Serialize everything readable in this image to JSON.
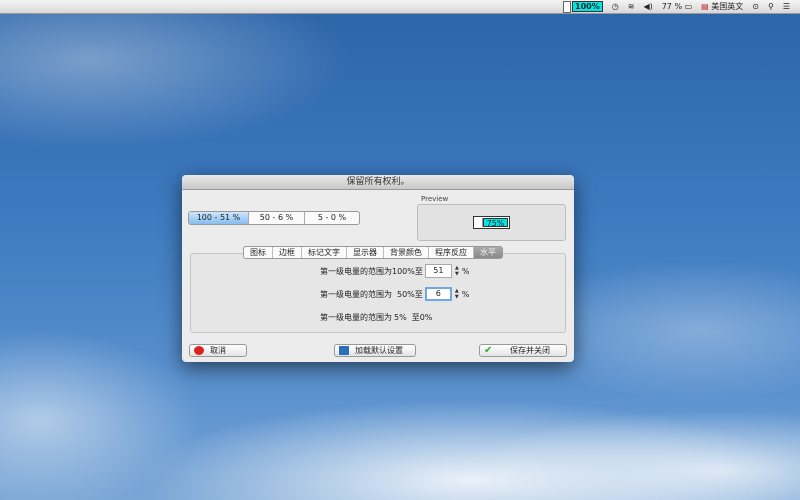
{
  "menubar": {
    "battery_percent": "100%",
    "volume_percent": "77 %",
    "input_source": "美国英文"
  },
  "dialog": {
    "title": "保留所有权利。",
    "ranges": [
      {
        "label": "100 - 51 %",
        "selected": true
      },
      {
        "label": "50 - 6 %",
        "selected": false
      },
      {
        "label": "5 - 0 %",
        "selected": false
      }
    ],
    "preview": {
      "label": "Preview",
      "battery_text": "75%"
    },
    "tabs": [
      {
        "label": "图标"
      },
      {
        "label": "边框"
      },
      {
        "label": "标记文字"
      },
      {
        "label": "显示器"
      },
      {
        "label": "背景颜色"
      },
      {
        "label": "程序反应"
      },
      {
        "label": "水平",
        "selected": true
      }
    ],
    "level1": {
      "label": "第一级电量的范围为100%至",
      "value": "51",
      "unit": "%"
    },
    "level2": {
      "label": "第一级电量的范围为",
      "from": "50%至",
      "value": "6",
      "unit": "%"
    },
    "level3": {
      "label": "第一级电量的范围为",
      "from": "5%",
      "to": "至0%"
    },
    "buttons": {
      "cancel": "取消",
      "load_defaults": "加载默认设置",
      "save_close": "保存并关闭"
    }
  },
  "colors": {
    "battery_fill": "#00e5e5",
    "selection": "#86bdf1"
  }
}
